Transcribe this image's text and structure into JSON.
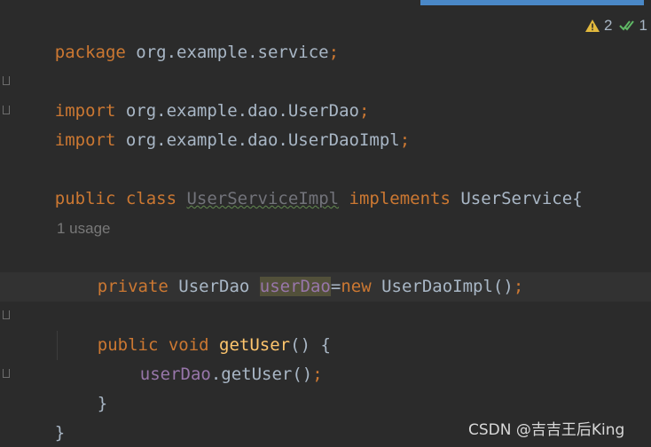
{
  "inspections": {
    "warning_count": "2",
    "ok_count": "1",
    "warning_icon": "warning-triangle-icon",
    "ok_icon": "double-check-icon",
    "warning_color": "#e2b93d",
    "ok_color": "#5fb865"
  },
  "code": {
    "line1": {
      "kw": "package",
      "rest": " org.example.service",
      "semi": ";"
    },
    "line3": {
      "kw": "import",
      "rest": " org.example.dao.UserDao",
      "semi": ";"
    },
    "line4": {
      "kw": "import",
      "rest": " org.example.dao.UserDaoImpl",
      "semi": ";"
    },
    "line6": {
      "kw1": "public class ",
      "classname": "UserServiceImpl",
      "kw2": " implements ",
      "iface": "UserService{"
    },
    "usage_hint": "1 usage",
    "line8": {
      "kw": "private",
      "type": " UserDao ",
      "field": "userDao",
      "eq": "=",
      "kw_new": "new",
      "ctor": " UserDaoImpl()",
      "semi": ";"
    },
    "line10": {
      "kw": "public void ",
      "method": "getUser",
      "rest": "() {"
    },
    "line11": {
      "field": "userDao",
      "call": ".getUser()",
      "semi": ";"
    },
    "line12": {
      "brace": "}"
    },
    "line13": {
      "brace": "}"
    }
  },
  "watermark": "CSDN @吉吉王后King",
  "colors": {
    "background": "#2b2b2b",
    "keyword": "#cc7832",
    "method": "#ffc66d",
    "field": "#9876aa",
    "text": "#a9b7c6"
  }
}
